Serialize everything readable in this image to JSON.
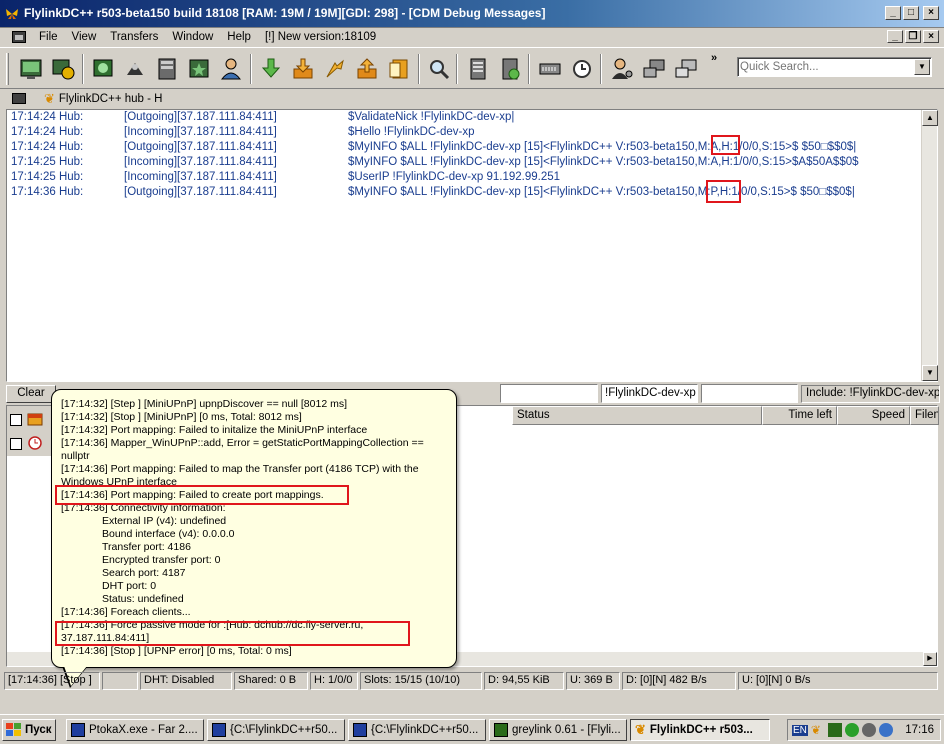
{
  "window": {
    "title": "FlylinkDC++ r503-beta150 build 18108 [RAM: 19M / 19M][GDI: 298] - [CDM Debug Messages]"
  },
  "menu": {
    "items": [
      "File",
      "View",
      "Transfers",
      "Window",
      "Help",
      "[!] New version:18109"
    ]
  },
  "toolbar": {
    "chevron": "»",
    "search_placeholder": "Quick Search...",
    "icons": [
      "public-hubs-icon",
      "favorite-hubs-icon",
      "reconnect-icon",
      "follow-redirect-icon",
      "favorite-users-icon",
      "recent-hubs-icon",
      "users-icon",
      "download-queue-icon",
      "finished-downloads-icon",
      "upload-queue-icon",
      "finished-uploads-icon",
      "notepad-icon",
      "search-icon",
      "search-spy-icon",
      "adl-search-icon",
      "network-stats-icon",
      "scheduler-icon",
      "settings-icon",
      "connect-icon",
      "disconnect-icon",
      "hash-icon"
    ]
  },
  "tabs": [
    {
      "label": "FlylinkDC++ hub - H"
    }
  ],
  "log": {
    "rows": [
      {
        "time": "17:14:24 Hub:",
        "dir": "[Outgoing][37.187.111.84:411]",
        "msg": "$ValidateNick !FlylinkDC-dev-xp|"
      },
      {
        "time": "17:14:24 Hub:",
        "dir": "[Incoming][37.187.111.84:411]",
        "msg": "$Hello !FlylinkDC-dev-xp"
      },
      {
        "time": "17:14:24 Hub:",
        "dir": "[Outgoing][37.187.111.84:411]",
        "msg": "$MyINFO $ALL !FlylinkDC-dev-xp [15]<FlylinkDC++ V:r503-beta150,M:A,H:1/0/0,S:15>$ $50□$$0$|"
      },
      {
        "time": "17:14:25 Hub:",
        "dir": "[Incoming][37.187.111.84:411]",
        "msg": "$MyINFO $ALL !FlylinkDC-dev-xp [15]<FlylinkDC++ V:r503-beta150,M:A,H:1/0/0,S:15>$A$50A$$0$"
      },
      {
        "time": "17:14:25 Hub:",
        "dir": "[Incoming][37.187.111.84:411]",
        "msg": "$UserIP !FlylinkDC-dev-xp 91.192.99.251"
      },
      {
        "time": "17:14:36 Hub:",
        "dir": "[Outgoing][37.187.111.84:411]",
        "msg": "$MyINFO $ALL !FlylinkDC-dev-xp [15]<FlylinkDC++ V:r503-beta150,M:P,H:1/0/0,S:15>$ $50□$$0$|"
      }
    ]
  },
  "filter": {
    "clear_label": "Clear",
    "nick_filter": "!FlylinkDC-dev-xp",
    "include_label": "Include: !FlylinkDC-dev-xp"
  },
  "transfers": {
    "columns": [
      "Status",
      "Time left",
      "Speed",
      "Filen"
    ]
  },
  "tooltip": {
    "lines": [
      "[17:14:32] [Step ] [MiniUPnP] upnpDiscover == null [8012 ms]",
      "[17:14:32] [Stop ] [MiniUPnP] [0 ms, Total: 8012 ms]",
      "[17:14:32] Port mapping: Failed to initalize the MiniUPnP interface",
      "[17:14:36] Mapper_WinUPnP::add, Error = getStaticPortMappingCollection ==",
      "nullptr",
      "[17:14:36] Port mapping: Failed to map the Transfer port (4186 TCP) with the",
      "Windows UPnP interface",
      "[17:14:36] Port mapping: Failed to create port mappings.",
      "[17:14:36] Connectivity information:"
    ],
    "details": [
      "External IP (v4): undefined",
      "Bound interface (v4): 0.0.0.0",
      "Transfer port: 4186",
      "Encrypted transfer port: 0",
      "Search port: 4187",
      "DHT port: 0",
      "Status: undefined"
    ],
    "tail_lines": [
      "[17:14:36] Foreach clients...",
      "[17:14:36] Force passive mode for :[Hub: dchub://dc.fly-server.ru,",
      "37.187.111.84:411]",
      "[17:14:36] [Stop ] [UPNP error] [0 ms, Total: 0 ms]"
    ]
  },
  "status": {
    "cells": [
      "[17:14:36] [Stop ]",
      "DHT: Disabled",
      "Shared: 0 B",
      "H: 1/0/0",
      "Slots: 15/15 (10/10)",
      "D: 94,55 KiB",
      "U: 369 B",
      "D: [0][N] 482 B/s",
      "U: [0][N] 0 B/s"
    ]
  },
  "taskbar": {
    "start_label": "Пуск",
    "tasks": [
      "PtokaX.exe - Far 2....",
      "{C:\\FlylinkDC++r50...",
      "{C:\\FlylinkDC++r50...",
      "greylink 0.61 - [Flyli...",
      "FlylinkDC++ r503..."
    ],
    "lang": "EN",
    "clock": "17:16"
  },
  "colors": {
    "log_text": "#1a3d8f",
    "highlight": "#e0161c",
    "tooltip_bg": "#ffffe1"
  }
}
